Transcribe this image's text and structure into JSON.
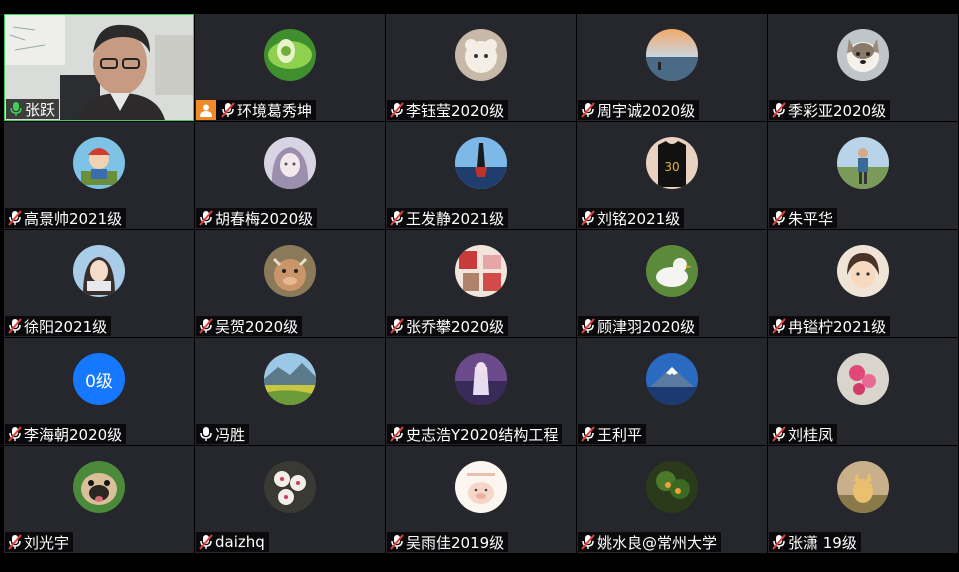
{
  "participants": [
    {
      "name": "张跃",
      "mic": "on",
      "video": true
    },
    {
      "name": "环境葛秀坤",
      "mic": "muted",
      "badge": "person-icon",
      "avatar": "leaf-sprout"
    },
    {
      "name": "李钰莹2020级",
      "mic": "muted",
      "avatar": "plush-toy"
    },
    {
      "name": "周宇诚2020级",
      "mic": "muted",
      "avatar": "sunset-lake"
    },
    {
      "name": "季彩亚2020级",
      "mic": "muted",
      "avatar": "dog"
    },
    {
      "name": "高景帅2021级",
      "mic": "muted",
      "avatar": "cartoon-boy"
    },
    {
      "name": "胡春梅2020级",
      "mic": "muted",
      "avatar": "anime-girl"
    },
    {
      "name": "王发静2021级",
      "mic": "muted",
      "avatar": "diver-sky"
    },
    {
      "name": "刘铭2021级",
      "mic": "muted",
      "avatar": "jersey-30"
    },
    {
      "name": "朱平华",
      "mic": "muted",
      "avatar": "man-outdoors"
    },
    {
      "name": "徐阳2021级",
      "mic": "muted",
      "avatar": "anime-girl-book"
    },
    {
      "name": "吴贺2020级",
      "mic": "muted",
      "avatar": "cartoon-bull"
    },
    {
      "name": "张乔攀2020级",
      "mic": "muted",
      "avatar": "collage"
    },
    {
      "name": "顾津羽2020级",
      "mic": "muted",
      "avatar": "white-duck"
    },
    {
      "name": "冉镒柠2021级",
      "mic": "muted",
      "avatar": "cartoon-face"
    },
    {
      "name": "李海朝2020级",
      "mic": "muted",
      "avatar_text": "0级"
    },
    {
      "name": "冯胜",
      "mic": "on",
      "avatar": "mountain-field"
    },
    {
      "name": "史志浩Y2020结构工程",
      "mic": "muted",
      "avatar": "purple-scene"
    },
    {
      "name": "王利平",
      "mic": "muted",
      "avatar": "mount-fuji"
    },
    {
      "name": "刘桂凤",
      "mic": "muted",
      "avatar": "pink-flower"
    },
    {
      "name": "刘光宇",
      "mic": "muted",
      "avatar": "pug"
    },
    {
      "name": "daizhq",
      "mic": "muted",
      "avatar": "white-orchid"
    },
    {
      "name": "吴雨佳2019级",
      "mic": "muted",
      "avatar": "cartoon-pig"
    },
    {
      "name": "姚水良@常州大学",
      "mic": "muted",
      "avatar": "fruit-tree"
    },
    {
      "name": "张潇 19级",
      "mic": "muted",
      "avatar": "cat-garden"
    }
  ],
  "colors": {
    "tile_bg": "#25272c",
    "active_border": "#3ecf5b",
    "mic_on": "#ffffff",
    "mic_muted_slash": "#e0433a",
    "badge": "#f08a24",
    "text_avatar_bg": "#1677ff"
  }
}
